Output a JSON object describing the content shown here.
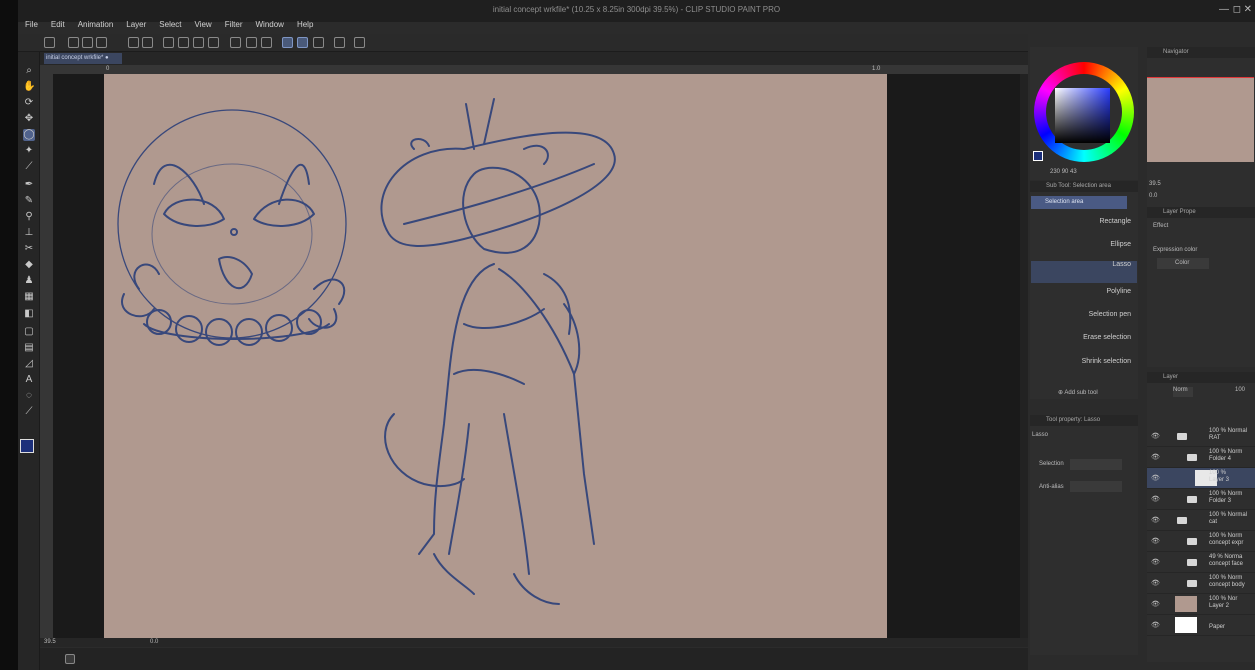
{
  "window": {
    "title": "initial concept wrkfile* (10.25 x 8.25in 300dpi 39.5%) - CLIP STUDIO PAINT PRO",
    "controls": [
      "—",
      "◻",
      "✕"
    ]
  },
  "menu": [
    "File",
    "Edit",
    "Animation",
    "Layer",
    "Select",
    "View",
    "Filter",
    "Window",
    "Help"
  ],
  "document_tab": {
    "label": "initial concept wrkfile*"
  },
  "ruler": {
    "mark0": "0",
    "mark1": "1.0"
  },
  "tools": [
    "search-icon",
    "hand-icon",
    "rotate-icon",
    "move-icon",
    "lasso-icon",
    "magic-wand-icon",
    "eyedropper-icon",
    "pen-icon",
    "pencil-icon",
    "brush-icon",
    "airbrush-icon",
    "decoration-icon",
    "eraser-icon",
    "blend-icon",
    "fill-icon",
    "gradient-icon",
    "figure-icon",
    "frame-icon",
    "ruler-icon",
    "text-icon",
    "balloon-icon",
    "correct-line-icon"
  ],
  "status": {
    "zoom": "39.5",
    "angle": "0.0"
  },
  "color": {
    "main": "#1c2f7a",
    "sub": "#ffffff",
    "h": "230",
    "s": "90",
    "v": "43"
  },
  "subtool": {
    "header": "Sub Tool: Selection area",
    "group": "Selection area",
    "items": [
      "Rectangle",
      "Ellipse",
      "Lasso",
      "Polyline",
      "Selection pen",
      "Erase selection",
      "Shrink selection"
    ],
    "selected": 2,
    "add_label": "Add sub tool"
  },
  "toolprop": {
    "header": "Tool property: Lasso",
    "name": "Lasso",
    "selection_label": "Selection",
    "antialias_label": "Anti-alias"
  },
  "navigator": {
    "header": "Navigator",
    "zoom": "39.5",
    "angle": "0.0"
  },
  "layerprop": {
    "header": "Layer Prope",
    "effect_label": "Effect",
    "expression_label": "Expression color",
    "expression_value": "Color"
  },
  "layers": {
    "header": "Layer",
    "blend": "Norm",
    "opacity": "100",
    "rows": [
      {
        "l1": "100 % Normal",
        "l2": "RAT",
        "type": "folder",
        "indent": 0
      },
      {
        "l1": "100 % Norm",
        "l2": "Folder 4",
        "type": "folder",
        "indent": 1
      },
      {
        "l1": "100 %",
        "l2": "Layer 3",
        "type": "layer",
        "indent": 2,
        "selected": true
      },
      {
        "l1": "100 % Norm",
        "l2": "Folder 3",
        "type": "folder",
        "indent": 1
      },
      {
        "l1": "100 % Normal",
        "l2": "cat",
        "type": "folder",
        "indent": 0
      },
      {
        "l1": "100 % Norm",
        "l2": "concept expr",
        "type": "folder",
        "indent": 1
      },
      {
        "l1": "49 % Norma",
        "l2": "concept face",
        "type": "folder",
        "indent": 1
      },
      {
        "l1": "100 % Norm",
        "l2": "concept body",
        "type": "folder",
        "indent": 1
      },
      {
        "l1": "100 % Nor",
        "l2": "Layer 2",
        "type": "layer",
        "indent": 0
      },
      {
        "l1": "",
        "l2": "Paper",
        "type": "paper",
        "indent": 0
      }
    ]
  }
}
